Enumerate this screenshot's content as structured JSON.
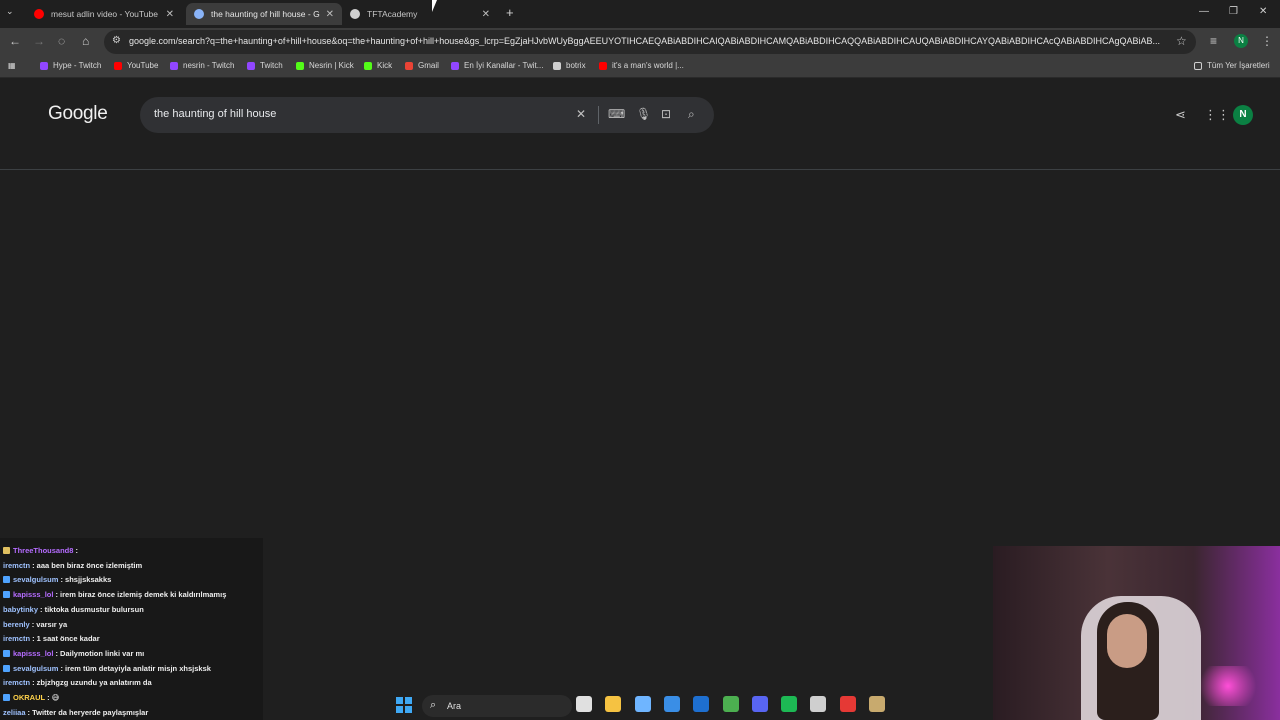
{
  "browser": {
    "tabs": [
      {
        "title": "mesut adlin video - YouTube",
        "favicon_color": "#ff0000"
      },
      {
        "title": "the haunting of hill house - Google",
        "favicon_color": "#8ab4f8"
      },
      {
        "title": "TFTAcademy",
        "favicon_color": "#cfcfcf"
      }
    ],
    "url": "google.com/search?q=the+haunting+of+hill+house&oq=the+haunting+of+hill+house&gs_lcrp=EgZjaHJvbWUyBggAEEUYOTIHCAEQABiABDIHCAIQABiABDIHCAMQABiABDIHCAQQABiABDIHCAUQABiABDIHCAYQABiABDIHCAcQABiABDIHCAgQABiAB...",
    "bookmarks": [
      {
        "label": "Hype - Twitch",
        "color": "#9146ff"
      },
      {
        "label": "YouTube",
        "color": "#ff0000"
      },
      {
        "label": "nesrin - Twitch",
        "color": "#9146ff"
      },
      {
        "label": "Twitch",
        "color": "#9146ff"
      },
      {
        "label": "Nesrin | Kick",
        "color": "#53fc18"
      },
      {
        "label": "Kick",
        "color": "#53fc18"
      },
      {
        "label": "Gmail",
        "color": "#ea4335"
      },
      {
        "label": "En İyi Kanallar - Twit...",
        "color": "#9146ff"
      },
      {
        "label": "botrix",
        "color": "#d0d0d0"
      },
      {
        "label": "it's a man's world |...",
        "color": "#ff0000"
      }
    ],
    "all_bookmarks_label": "Tüm Yer İşaretleri"
  },
  "google": {
    "logo": "Google",
    "query": "the haunting of hill house",
    "avatar_initial": "N"
  },
  "chat": {
    "messages": [
      {
        "user": "ThreeThousand8",
        "text": "",
        "color": "#b56cff",
        "badge": "#e0c060"
      },
      {
        "user": "iremctn",
        "text": "aaa ben biraz önce izlemiştim",
        "color": "#9fc2ff",
        "badge": ""
      },
      {
        "user": "sevalgulsum",
        "text": "shsjjsksakks",
        "color": "#9fc2ff",
        "badge": "#4fa3ff"
      },
      {
        "user": "kapisss_lol",
        "text": "irem biraz önce izlemiş demek ki kaldırılmamış",
        "color": "#b56cff",
        "badge": "#4fa3ff"
      },
      {
        "user": "babytinky",
        "text": "tiktoka dusmustur bulursun",
        "color": "#9fc2ff",
        "badge": ""
      },
      {
        "user": "berenly",
        "text": "varsır ya",
        "color": "#9fc2ff",
        "badge": ""
      },
      {
        "user": "iremctn",
        "text": "1 saat önce kadar",
        "color": "#9fc2ff",
        "badge": ""
      },
      {
        "user": "kapisss_lol",
        "text": "Dailymotion linki var mı",
        "color": "#b56cff",
        "badge": "#4fa3ff"
      },
      {
        "user": "sevalgulsum",
        "text": "irem tüm detayiyla anlatir misjn xhsjsksk",
        "color": "#9fc2ff",
        "badge": "#4fa3ff"
      },
      {
        "user": "iremctn",
        "text": "zbjzhgzg uzundu ya anlatırım da",
        "color": "#9fc2ff",
        "badge": ""
      },
      {
        "user": "OKRAUL",
        "text": "😅",
        "color": "#ffd24a",
        "badge": "#4fa3ff"
      },
      {
        "user": "zeliiaa",
        "text": "Twitter da heryerde paylaşmışlar",
        "color": "#9fc2ff",
        "badge": ""
      }
    ]
  },
  "taskbar": {
    "search_label": "Ara",
    "apps": [
      {
        "name": "task-view",
        "color": "#e0e0e0"
      },
      {
        "name": "file-explorer",
        "color": "#f5c242"
      },
      {
        "name": "copilot",
        "color": "#6fb5ff"
      },
      {
        "name": "store",
        "color": "#3a8ee6"
      },
      {
        "name": "outlook",
        "color": "#1e6fd0"
      },
      {
        "name": "chrome",
        "color": "#4caf50"
      },
      {
        "name": "discord",
        "color": "#5865f2"
      },
      {
        "name": "spotify",
        "color": "#1db954"
      },
      {
        "name": "obs",
        "color": "#cfcfcf"
      },
      {
        "name": "streamlabs",
        "color": "#e53935"
      },
      {
        "name": "league",
        "color": "#c8aa6e"
      }
    ]
  }
}
